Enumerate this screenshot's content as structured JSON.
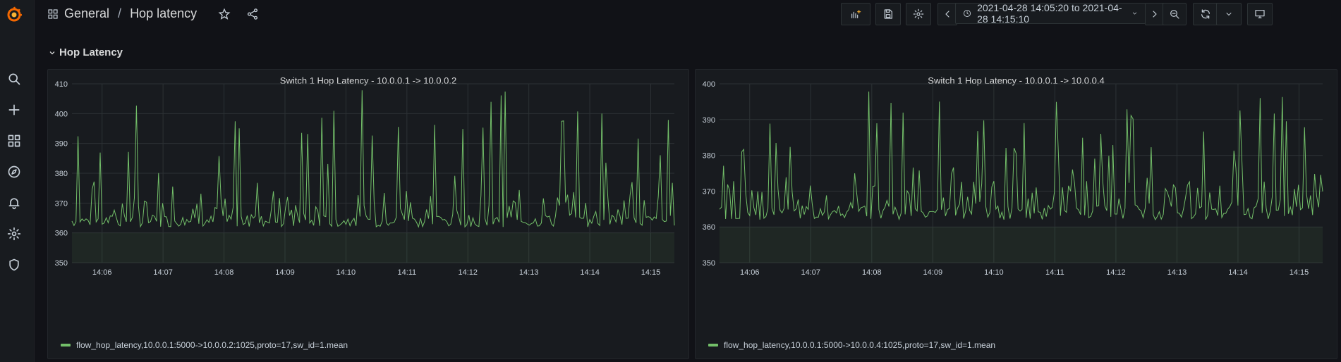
{
  "breadcrumb": {
    "folder": "General",
    "separator": "/",
    "dashboard": "Hop latency"
  },
  "time_range": {
    "label": "2021-04-28 14:05:20 to 2021-04-28 14:15:10"
  },
  "row": {
    "title": "Hop Latency"
  },
  "colors": {
    "series": "#73bf69",
    "background": "#111217",
    "panel": "#181b1f",
    "grid": "#2c3235",
    "text": "#d8d9da"
  },
  "panels": [
    {
      "title": "Switch 1 Hop Latency - 10.0.0.1 -> 10.0.0.2",
      "legend": "flow_hop_latency,10.0.0.1:5000->10.0.0.2:1025,proto=17,sw_id=1.mean",
      "ymin": 350,
      "ymax": 410,
      "yticks": [
        "410",
        "400",
        "390",
        "380",
        "370",
        "360",
        "350"
      ],
      "xticks": [
        "14:06",
        "14:07",
        "14:08",
        "14:09",
        "14:10",
        "14:11",
        "14:12",
        "14:13",
        "14:14",
        "14:15"
      ],
      "seed": 7,
      "peak": 400,
      "peak_pos": 0.881
    },
    {
      "title": "Switch 1 Hop Latency - 10.0.0.1 -> 10.0.0.4",
      "legend": "flow_hop_latency,10.0.0.1:5000->10.0.0.4:1025,proto=17,sw_id=1.mean",
      "ymin": 350,
      "ymax": 400,
      "yticks": [
        "400",
        "390",
        "380",
        "370",
        "360",
        "350"
      ],
      "xticks": [
        "14:06",
        "14:07",
        "14:08",
        "14:09",
        "14:10",
        "14:11",
        "14:12",
        "14:13",
        "14:14",
        "14:15"
      ],
      "seed": 13,
      "peak": 396,
      "peak_pos": 0.896
    }
  ]
}
